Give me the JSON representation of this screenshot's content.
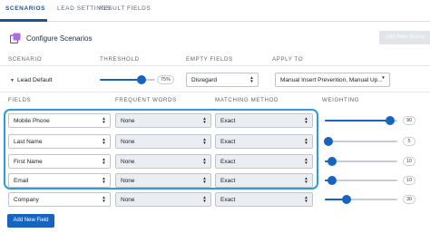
{
  "tabs": [
    {
      "label": "SCENARIOS",
      "active": true
    },
    {
      "label": "LEAD SETTINGS",
      "active": false
    },
    {
      "label": "RESULT FIELDS",
      "active": false
    }
  ],
  "header": {
    "title": "Configure Scenarios",
    "icon": "scenarios-icon",
    "add_new_label": "Add New Scena"
  },
  "scenario_table": {
    "headers": [
      "SCENARIO",
      "THRESHOLD",
      "EMPTY FIELDS",
      "APPLY TO"
    ],
    "row": {
      "name": "Lead Default",
      "threshold": 75,
      "threshold_label": "75%",
      "empty_fields": "Disregard",
      "apply_to": "Manual Insert Prevention, Manual Up..."
    }
  },
  "fields_table": {
    "headers": [
      "FIELDS",
      "FREQUENT WORDS",
      "MATCHING METHOD",
      "WEIGHTING"
    ],
    "rows": [
      {
        "field": "Mobile Phone",
        "frequent_words": "None",
        "matching_method": "Exact",
        "weighting": 90,
        "weighting_label": "90",
        "highlighted": true
      },
      {
        "field": "Last Name",
        "frequent_words": "None",
        "matching_method": "Exact",
        "weighting": 5,
        "weighting_label": "5",
        "highlighted": true
      },
      {
        "field": "First Name",
        "frequent_words": "None",
        "matching_method": "Exact",
        "weighting": 10,
        "weighting_label": "10",
        "highlighted": true
      },
      {
        "field": "Email",
        "frequent_words": "None",
        "matching_method": "Exact",
        "weighting": 10,
        "weighting_label": "10",
        "highlighted": true
      },
      {
        "field": "Company",
        "frequent_words": "None",
        "matching_method": "Exact",
        "weighting": 30,
        "weighting_label": "30",
        "highlighted": false
      }
    ],
    "add_field_label": "Add New Field"
  },
  "colors": {
    "accent": "#1764c0",
    "highlight": "#2e9ae6",
    "tab_active": "#1b5297"
  }
}
